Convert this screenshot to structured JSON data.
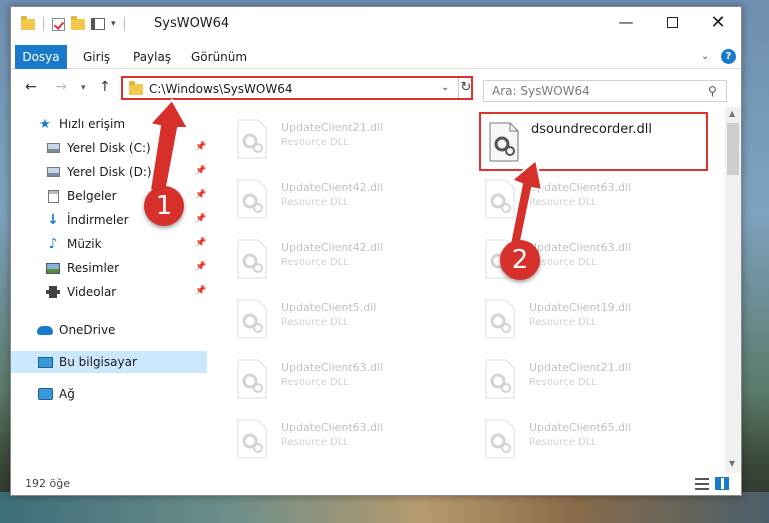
{
  "window": {
    "title": "SysWOW64"
  },
  "ribbon": {
    "tabs": [
      "Dosya",
      "Giriş",
      "Paylaş",
      "Görünüm"
    ]
  },
  "address_bar": {
    "path": "C:\\Windows\\SysWOW64"
  },
  "search": {
    "placeholder": "Ara: SysWOW64"
  },
  "sidebar": {
    "quick_access": "Hızlı erişim",
    "items": [
      {
        "label": "Yerel Disk (C:)",
        "icon": "drive-icon",
        "pinned": true
      },
      {
        "label": "Yerel Disk (D:)",
        "icon": "drive-icon",
        "pinned": true
      },
      {
        "label": "Belgeler",
        "icon": "documents-icon",
        "pinned": true
      },
      {
        "label": "İndirmeler",
        "icon": "download-icon",
        "pinned": true
      },
      {
        "label": "Müzik",
        "icon": "music-icon",
        "pinned": true
      },
      {
        "label": "Resimler",
        "icon": "pictures-icon",
        "pinned": true
      },
      {
        "label": "Videolar",
        "icon": "videos-icon",
        "pinned": true
      }
    ],
    "onedrive": "OneDrive",
    "this_pc": "Bu bilgisayar",
    "network": "Ağ"
  },
  "files": {
    "highlighted": {
      "name": "dsoundrecorder.dll"
    },
    "left_column": [
      {
        "name": "UpdateClient21.dll",
        "type": "Resource DLL"
      },
      {
        "name": "UpdateClient42.dll",
        "type": "Resource DLL"
      },
      {
        "name": "UpdateClient42.dll",
        "type": "Resource DLL"
      },
      {
        "name": "UpdateClient5.dll",
        "type": "Resource DLL"
      },
      {
        "name": "UpdateClient63.dll",
        "type": "Resource DLL"
      },
      {
        "name": "UpdateClient63.dll",
        "type": "Resource DLL"
      }
    ],
    "right_column": [
      {
        "name": "UpdateClient63.dll",
        "type": "Resource DLL"
      },
      {
        "name": "UpdateClient63.dll",
        "type": "Resource DLL"
      },
      {
        "name": "UpdateClient19.dll",
        "type": "Resource DLL"
      },
      {
        "name": "UpdateClient21.dll",
        "type": "Resource DLL"
      },
      {
        "name": "UpdateClient65.dll",
        "type": "Resource DLL"
      }
    ]
  },
  "status": {
    "count": "192 öğe"
  },
  "annotations": {
    "step1": "1",
    "step2": "2",
    "color": "#d7302a"
  },
  "colors": {
    "accent": "#1979ca",
    "highlight_border": "#e0312f",
    "selected_bg": "#cce8ff"
  }
}
